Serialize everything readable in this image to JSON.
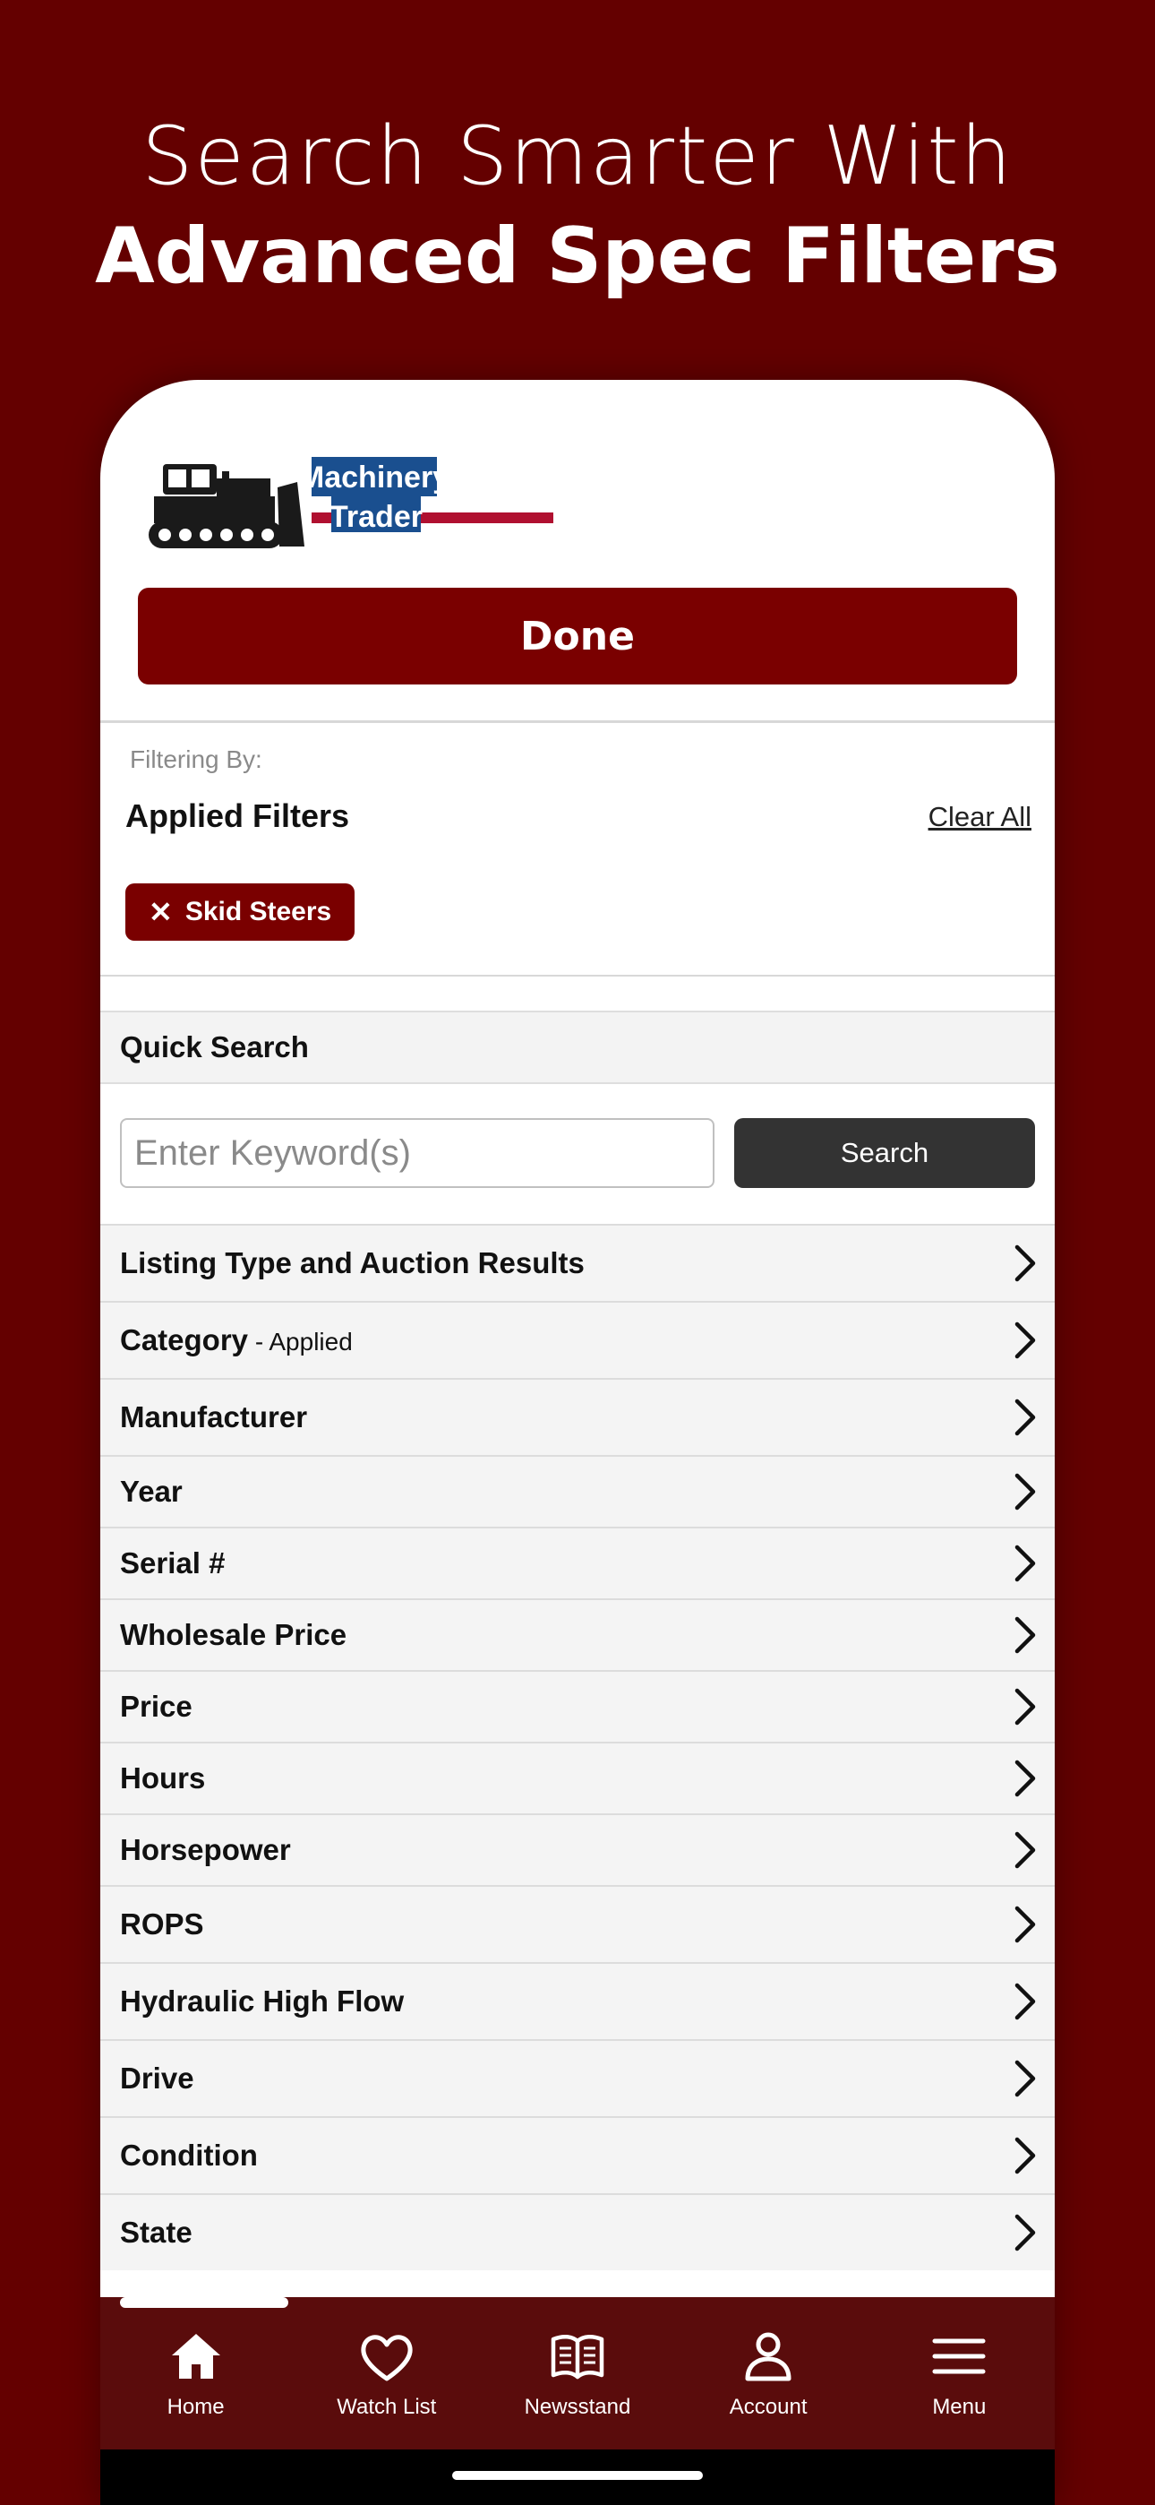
{
  "headline": {
    "line1": "Search Smarter With",
    "line2": "Advanced Spec Filters"
  },
  "logo": {
    "text_line1": "Machinery",
    "text_line2": "Trader"
  },
  "done_label": "Done",
  "filters": {
    "filtering_by_label": "Filtering By:",
    "applied_title": "Applied Filters",
    "clear_all_label": "Clear All",
    "chips": [
      {
        "label": "Skid Steers"
      }
    ]
  },
  "quick_search": {
    "title": "Quick Search",
    "placeholder": "Enter Keyword(s)",
    "search_label": "Search"
  },
  "filter_rows": [
    {
      "label": "Listing Type and Auction Results",
      "sub": ""
    },
    {
      "label": "Category",
      "sub": " - Applied"
    },
    {
      "label": "Manufacturer",
      "sub": ""
    },
    {
      "label": "Year",
      "sub": ""
    },
    {
      "label": "Serial #",
      "sub": ""
    },
    {
      "label": "Wholesale Price",
      "sub": ""
    },
    {
      "label": "Price",
      "sub": ""
    },
    {
      "label": "Hours",
      "sub": ""
    },
    {
      "label": "Horsepower",
      "sub": ""
    },
    {
      "label": "ROPS",
      "sub": ""
    },
    {
      "label": "Hydraulic High Flow",
      "sub": ""
    },
    {
      "label": "Drive",
      "sub": ""
    },
    {
      "label": "Condition",
      "sub": ""
    },
    {
      "label": "State",
      "sub": ""
    }
  ],
  "bottom_nav": [
    {
      "label": "Home",
      "icon": "home-icon"
    },
    {
      "label": "Watch List",
      "icon": "heart-icon"
    },
    {
      "label": "Newsstand",
      "icon": "book-icon"
    },
    {
      "label": "Account",
      "icon": "user-icon"
    },
    {
      "label": "Menu",
      "icon": "menu-icon"
    }
  ],
  "colors": {
    "background": "#640000",
    "accent": "#7a0000",
    "nav": "#5a0c0c",
    "search_button": "#333333",
    "logo_blue": "#1a4f8f"
  }
}
